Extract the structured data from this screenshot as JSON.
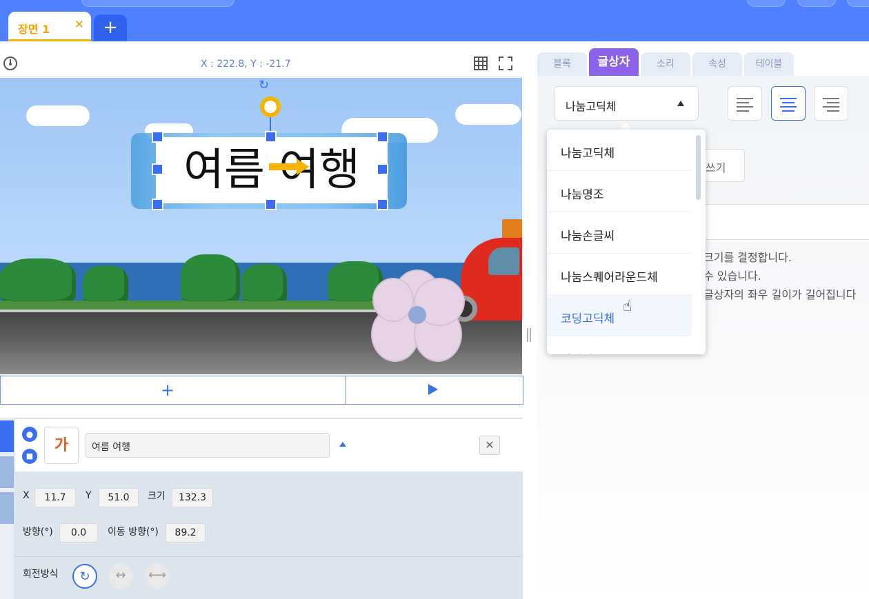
{
  "scene_tabs": {
    "active_label": "장면 1",
    "close_glyph": "✕",
    "add_glyph": "+"
  },
  "stage": {
    "coordinates": "X : 222.8, Y : -21.7",
    "title_text": "여름 여행",
    "footer_add_glyph": "+"
  },
  "object": {
    "thumb_glyph": "가",
    "name": "여름 여행",
    "delete_glyph": "✕",
    "x_label": "X",
    "x_value": "11.7",
    "y_label": "Y",
    "y_value": "51.0",
    "size_label": "크기",
    "size_value": "132.3",
    "direction_label": "방향(°)",
    "direction_value": "0.0",
    "move_direction_label": "이동 방향(°)",
    "move_direction_value": "89.2",
    "rotation_label": "회전방식"
  },
  "right_tabs": [
    {
      "label": "블록"
    },
    {
      "label": "글상자"
    },
    {
      "label": "소리"
    },
    {
      "label": "속성"
    },
    {
      "label": "테이블"
    }
  ],
  "font": {
    "selected": "나눔고딕체",
    "options": [
      "나눔고딕체",
      "나눔명조",
      "나눔손글씨",
      "나눔스퀘어라운드체",
      "코딩고딕체",
      "잘난체"
    ]
  },
  "write_button_label": "쓰기",
  "help_lines": [
    "크기를 결정합니다.",
    "수 있습니다.",
    "글상자의 좌우 길이가 길어집니다"
  ],
  "colors": {
    "accent": "#3a6ff2",
    "header": "#4f80ff",
    "tab_active": "#8a63e8",
    "scene_tab": "#f5a300"
  },
  "icons": [
    "speed-icon",
    "grid-icon",
    "fullscreen-icon",
    "eye-icon",
    "lock-icon",
    "close-icon",
    "plus-icon",
    "play-icon",
    "rotate-icon",
    "hand-cursor-icon"
  ]
}
